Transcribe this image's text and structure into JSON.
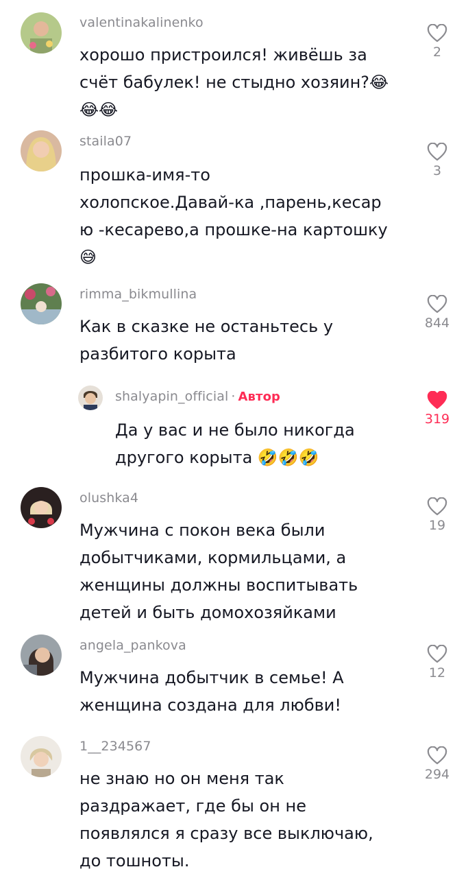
{
  "comments": [
    {
      "username": "valentinakalinenko",
      "text": "хорошо пристроился! живёшь за\nсчёт бабулек! не стыдно хозяин?😂\n😂😂",
      "likes": "2",
      "liked": false,
      "avatar_color": "#b5c98a"
    },
    {
      "username": "staila07",
      "text": "прошка-имя-то\nхолопское.Давай-ка ,парень,кесар\nю -кесарево,а прошке-на картошку\n😅",
      "likes": "3",
      "liked": false,
      "avatar_color": "#d9b9a0"
    },
    {
      "username": "rimma_bikmullina",
      "text": "Как в сказке не останьтесь у\nразбитого корыта",
      "likes": "844",
      "liked": false,
      "avatar_color": "#7a9a6a"
    },
    {
      "username": "shalyapin_official",
      "author_label": "Автор",
      "text": "Да у вас и не было никогда\nдругого корыта 🤣🤣🤣",
      "likes": "319",
      "liked": true,
      "avatar_color": "#8c7a6a"
    },
    {
      "username": "olushka4",
      "text": "Мужчина с покон века были\nдобытчиками, кормильцами, а\nженщины должны воспитывать\nдетей и быть домохозяйками",
      "likes": "19",
      "liked": false,
      "avatar_color": "#c7a88a"
    },
    {
      "username": "angela_pankova",
      "text": "Мужчина добытчик в семье! А\nженщина создана для любви!",
      "likes": "12",
      "liked": false,
      "avatar_color": "#8a8f96"
    },
    {
      "username": "1__234567",
      "text": "не знаю но он меня так\nраздражает, где бы он не\nпоявлялся я сразу все выключаю,\nдо тошноты.",
      "likes": "294",
      "liked": false,
      "avatar_color": "#d6cbb8"
    }
  ],
  "colors": {
    "accent": "#fe2c55",
    "secondary_text": "#8a8a8f",
    "primary_text": "#161823"
  }
}
